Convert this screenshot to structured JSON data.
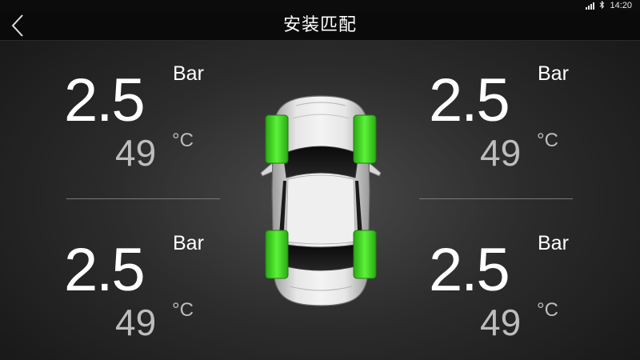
{
  "status_bar": {
    "time": "14:20"
  },
  "header": {
    "title": "安装匹配"
  },
  "tires": {
    "front_left": {
      "pressure": "2.5",
      "pressure_unit": "Bar",
      "temperature": "49",
      "temperature_unit": "°C"
    },
    "front_right": {
      "pressure": "2.5",
      "pressure_unit": "Bar",
      "temperature": "49",
      "temperature_unit": "°C"
    },
    "rear_left": {
      "pressure": "2.5",
      "pressure_unit": "Bar",
      "temperature": "49",
      "temperature_unit": "°C"
    },
    "rear_right": {
      "pressure": "2.5",
      "pressure_unit": "Bar",
      "temperature": "49",
      "temperature_unit": "°C"
    }
  },
  "colors": {
    "tire_ok": "#3fd61f",
    "background": "#2c2c2c",
    "title_bar": "#0a0a0a"
  }
}
